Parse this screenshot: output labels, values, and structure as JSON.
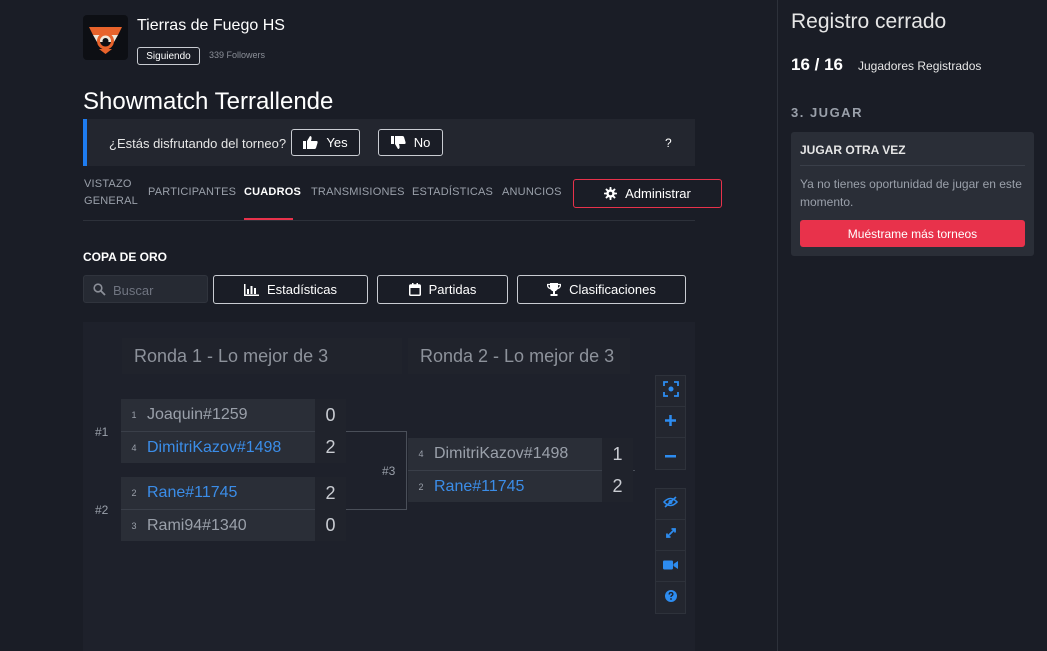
{
  "org": {
    "name": "Tierras de Fuego HS",
    "follow_label": "Siguiendo",
    "followers": "339 Followers"
  },
  "tournament": {
    "title": "Showmatch Terrallende"
  },
  "feedback": {
    "question": "¿Estás disfrutando del torneo?",
    "yes": "Yes",
    "no": "No",
    "help": "?"
  },
  "tabs": [
    {
      "line1": "VISTAZO",
      "line2": "GENERAL"
    },
    {
      "line1": "PARTICIPANTES"
    },
    {
      "line1": "CUADROS"
    },
    {
      "line1": "TRANSMISIONES"
    },
    {
      "line1": "ESTADÍSTICAS"
    },
    {
      "line1": "ANUNCIOS"
    }
  ],
  "admin_label": "Administrar",
  "section": {
    "title": "COPA DE ORO",
    "search_placeholder": "Buscar",
    "stats_label": "Estadísticas",
    "matches_label": "Partidas",
    "standings_label": "Clasificaciones"
  },
  "bracket": {
    "rounds": [
      "Ronda 1 - Lo mejor de 3",
      "Ronda 2 - Lo mejor de 3"
    ],
    "matches": [
      {
        "label": "#1",
        "players": [
          {
            "seed": "1",
            "name": "Joaquin#1259",
            "score": "0",
            "winner": false
          },
          {
            "seed": "4",
            "name": "DimitriKazov#1498",
            "score": "2",
            "winner": true
          }
        ]
      },
      {
        "label": "#2",
        "players": [
          {
            "seed": "2",
            "name": "Rane#11745",
            "score": "2",
            "winner": true
          },
          {
            "seed": "3",
            "name": "Rami94#1340",
            "score": "0",
            "winner": false
          }
        ]
      },
      {
        "label": "#3",
        "players": [
          {
            "seed": "4",
            "name": "DimitriKazov#1498",
            "score": "1",
            "winner": false
          },
          {
            "seed": "2",
            "name": "Rane#11745",
            "score": "2",
            "winner": true
          }
        ]
      }
    ]
  },
  "sidebar": {
    "status": "Registro cerrado",
    "count": "16 / 16",
    "count_label": "Jugadores Registrados",
    "step": "3. JUGAR",
    "card_title": "JUGAR OTRA VEZ",
    "card_text": "Ya no tienes oportunidad de jugar en este momento.",
    "card_button": "Muéstrame más torneos"
  },
  "colors": {
    "accent": "#e8324b",
    "link": "#3b8de8",
    "info": "#1e7cf0",
    "background": "#1a1d26"
  }
}
